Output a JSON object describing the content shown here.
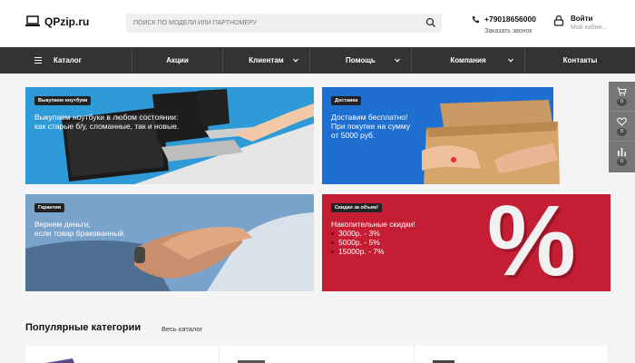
{
  "header": {
    "logo_text": "QPzip.ru",
    "search_placeholder": "ПОИСК ПО МОДЕЛИ ИЛИ ПАРТНОМЕРУ",
    "phone": "+79018656000",
    "callback": "Заказать звонок",
    "login_title": "Войти",
    "login_sub": "Мой кабин..."
  },
  "nav": {
    "items": [
      {
        "label": "Каталог"
      },
      {
        "label": "Акции"
      },
      {
        "label": "Клиентам"
      },
      {
        "label": "Помощь"
      },
      {
        "label": "Компания"
      },
      {
        "label": "Контакты"
      }
    ]
  },
  "banners": [
    {
      "badge": "Выкупаем ноутбуки",
      "lines": [
        "Выкупаем ноутбуки в любом состоянии:",
        "как старые б/у, сломанные, так и новые."
      ]
    },
    {
      "badge": "Доставка",
      "lines": [
        "Доставим бесплатно!",
        "При покупке на сумму",
        "от 5000 руб."
      ]
    },
    {
      "badge": "Гарантия",
      "lines": [
        "Вернем деньги,",
        "если товар бракованный."
      ]
    },
    {
      "badge": "Скидки за объем!",
      "lines": [
        "Накопительные скидки!"
      ],
      "bullets": [
        "3000р. - 3%",
        "5000р. - 5%",
        "15000р. - 7%"
      ],
      "big_symbol": "%"
    }
  ],
  "popular": {
    "title": "Популярные категории",
    "all_link": "Весь каталог"
  },
  "side_panel": {
    "cart_count": "0",
    "favorites_count": "0",
    "compare_count": "0"
  },
  "colors": {
    "nav_bg": "#333333",
    "banner_delivery_bg": "#1f6fd1",
    "banner_sale_bg": "#c51d33",
    "side_panel_bg": "#777777"
  }
}
